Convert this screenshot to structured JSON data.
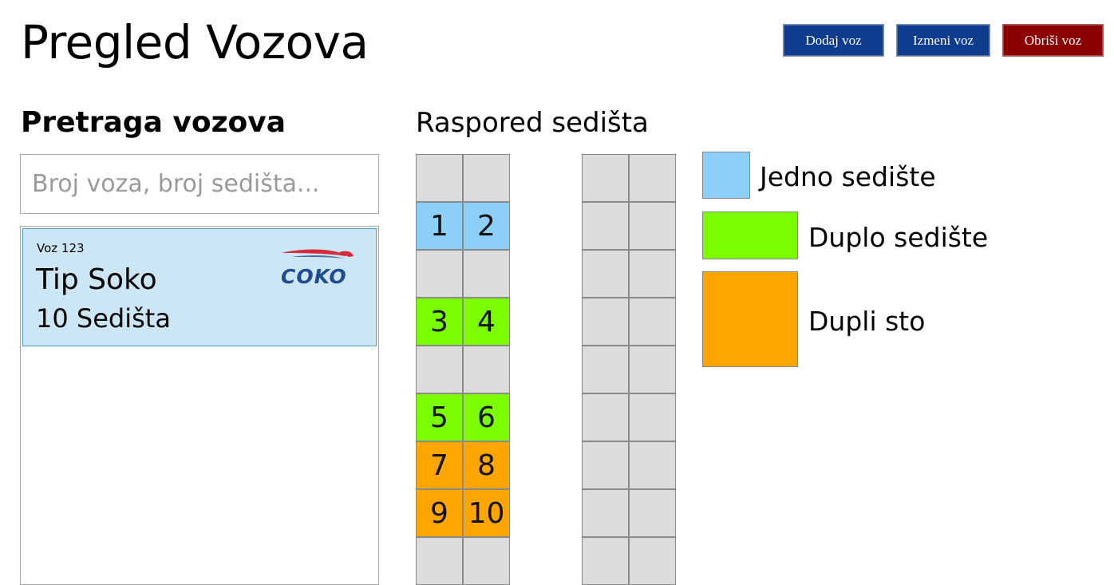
{
  "header": {
    "title": "Pregled Vozova",
    "buttons": {
      "add": "Dodaj voz",
      "edit": "Izmeni voz",
      "delete": "Obriši voz"
    }
  },
  "search_panel": {
    "title": "Pretraga vozova",
    "placeholder": "Broj voza, broj sedišta...",
    "trains": [
      {
        "id": "Voz 123",
        "type": "Tip Soko",
        "seats": "10 Sedišta",
        "logo": "COKO"
      }
    ]
  },
  "seating": {
    "title": "Raspored sedišta",
    "left_rows": [
      [
        "",
        ""
      ],
      [
        "1",
        "2"
      ],
      [
        "",
        ""
      ],
      [
        "3",
        "4"
      ],
      [
        "",
        ""
      ],
      [
        "5",
        "6"
      ],
      [
        "7",
        "8"
      ],
      [
        "9",
        "10"
      ],
      [
        "",
        ""
      ]
    ],
    "left_row_colors": [
      "#dcdcdc",
      "#8ccff8",
      "#dcdcdc",
      "#7cfc00",
      "#dcdcdc",
      "#7cfc00",
      "#ffa500",
      "#ffa500",
      "#dcdcdc"
    ],
    "right_rows": [
      [
        "",
        ""
      ],
      [
        "",
        ""
      ],
      [
        "",
        ""
      ],
      [
        "",
        ""
      ],
      [
        "",
        ""
      ],
      [
        "",
        ""
      ],
      [
        "",
        ""
      ],
      [
        "",
        ""
      ],
      [
        "",
        ""
      ]
    ]
  },
  "legend": [
    {
      "label": "Jedno sedište",
      "color": "#8ccff8"
    },
    {
      "label": "Duplo sedište",
      "color": "#7cfc00"
    },
    {
      "label": "Dupli sto",
      "color": "#ffa500"
    }
  ]
}
